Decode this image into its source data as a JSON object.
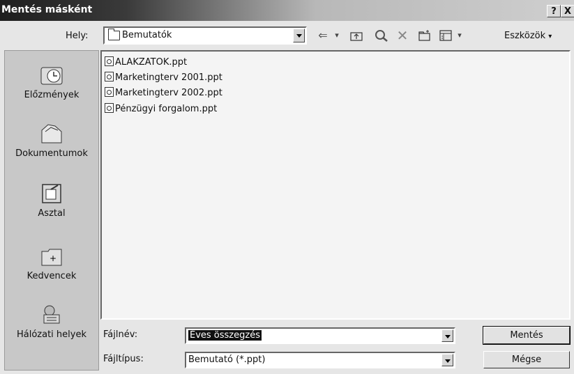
{
  "window": {
    "title": "Mentés másként",
    "help_button": "?",
    "close_button": "X"
  },
  "toolbar": {
    "location_label": "Hely:",
    "location_value": "Bemutatók",
    "tools_menu_label": "Eszközök"
  },
  "places": [
    {
      "label": "Előzmények",
      "icon": "history-icon"
    },
    {
      "label": "Dokumentumok",
      "icon": "documents-folder-icon"
    },
    {
      "label": "Asztal",
      "icon": "desktop-icon"
    },
    {
      "label": "Kedvencek",
      "icon": "favorites-folder-icon"
    },
    {
      "label": "Hálózati helyek",
      "icon": "network-places-icon"
    }
  ],
  "files": [
    "ALAKZATOK.ppt",
    "Marketingterv 2001.ppt",
    "Marketingterv 2002.ppt",
    "Pénzügyi forgalom.ppt"
  ],
  "filename": {
    "label": "Fájlnév:",
    "value": "Éves összegzés"
  },
  "filetype": {
    "label": "Fájltípus:",
    "value": "Bemutató (*.ppt)"
  },
  "buttons": {
    "save": "Mentés",
    "cancel": "Mégse"
  }
}
